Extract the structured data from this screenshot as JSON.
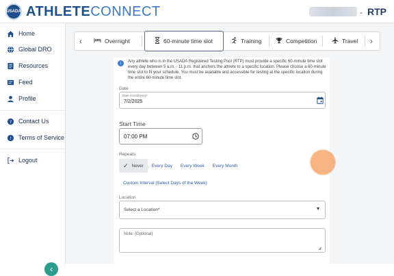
{
  "header": {
    "logo_badge": "USADA",
    "logo_bold": "ATHLETE",
    "logo_light": "CONNECT",
    "separator": "-",
    "org": "RTP"
  },
  "sidebar": {
    "items": [
      {
        "label": "Home",
        "icon": "home-icon"
      },
      {
        "label": "Global DRO",
        "icon": "globe-icon"
      },
      {
        "label": "Resources",
        "icon": "resources-icon"
      },
      {
        "label": "Feed",
        "icon": "feed-icon"
      },
      {
        "label": "Profile",
        "icon": "profile-icon"
      },
      {
        "label": "Contact Us",
        "icon": "contact-icon"
      },
      {
        "label": "Terms of Service",
        "icon": "terms-icon"
      },
      {
        "label": "Logout",
        "icon": "logout-icon"
      }
    ],
    "collapse_glyph": "‹"
  },
  "tabs": {
    "prev": "‹",
    "next": "›",
    "items": [
      {
        "label": "Overnight",
        "icon": "bed-icon"
      },
      {
        "label": "60-minute time slot",
        "icon": "hourglass-icon"
      },
      {
        "label": "Training",
        "icon": "running-icon"
      },
      {
        "label": "Competition",
        "icon": "trophy-icon"
      },
      {
        "label": "Travel",
        "icon": "airplane-icon"
      }
    ],
    "active_index": 1
  },
  "info_text": "Any athlete who is in the USADA Registered Testing Pool (RTP) must provide a specific 60-minute time slot every day between 5 a.m. - 11 p.m. that anchors the athlete to a specific location. Please choose a 60-minute time slot to fit your schedule. You must be available and accessible for testing at the specific location during the entire 60-minute time slot.",
  "date": {
    "label": "Date",
    "hint": "Date mm/dd/yyyy*",
    "value": "7/2/2025"
  },
  "start_time": {
    "label": "Start Time",
    "value": "07:00 PM"
  },
  "repeats": {
    "label": "Repeats",
    "options": [
      "Never",
      "Every Day",
      "Every Week",
      "Every Month"
    ],
    "selected": "Never",
    "custom": "Custom Interval (Select Days of the Week)"
  },
  "location": {
    "label": "Location",
    "placeholder": "Select a Location*"
  },
  "note": {
    "placeholder": "Note: (Optional)"
  },
  "colors": {
    "brand": "#1f4e8c",
    "accent": "#2a9d8f",
    "highlight": "#f69c5a"
  }
}
